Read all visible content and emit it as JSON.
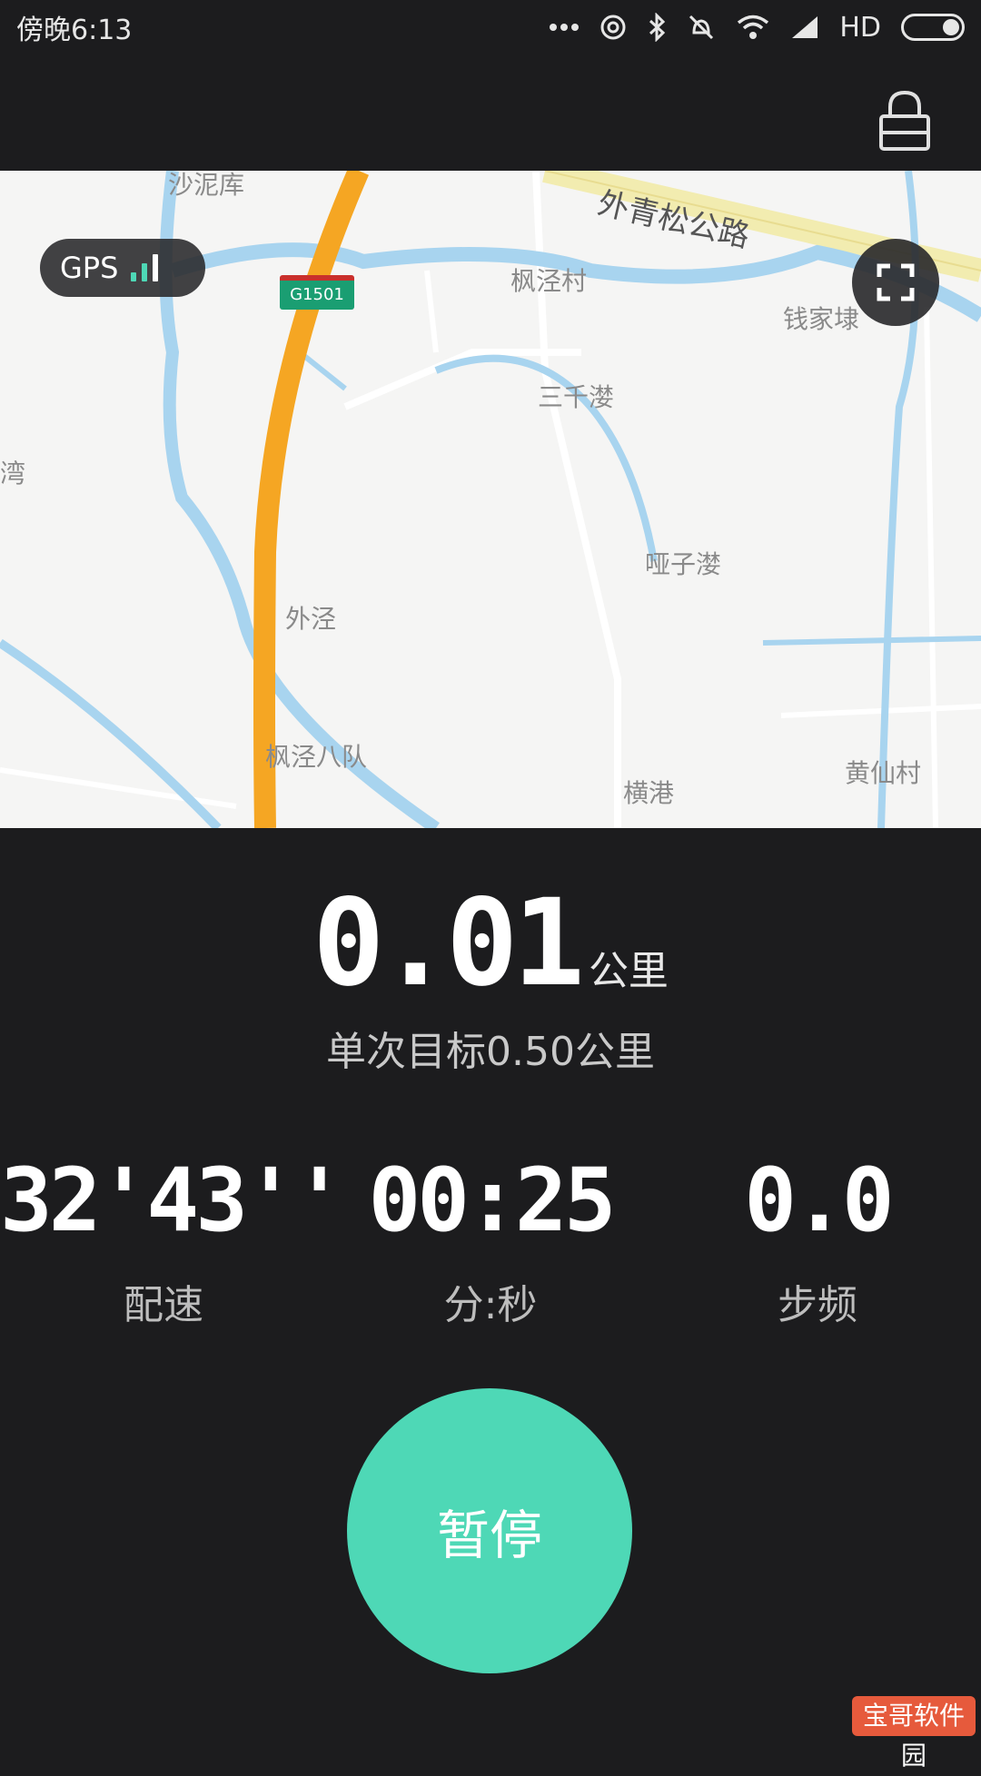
{
  "status": {
    "time": "傍晚6:13",
    "network": "HD"
  },
  "map": {
    "gps_label": "GPS",
    "highway_shield": "G1501",
    "road_name": "外青松公路",
    "places": [
      "沙泥库",
      "枫泾村",
      "钱家埭",
      "三千漤",
      "湾",
      "哑子漤",
      "外泾",
      "枫泾八队",
      "横港",
      "黄仙村"
    ]
  },
  "run": {
    "distance_value": "0.01",
    "distance_unit": "公里",
    "goal_text": "单次目标0.50公里",
    "metrics": [
      {
        "value": "32'43''",
        "label": "配速"
      },
      {
        "value": "00:25",
        "label": "分:秒"
      },
      {
        "value": "0.0",
        "label": "步频"
      }
    ],
    "pause_label": "暂停"
  },
  "watermark": "宝哥软件园",
  "colors": {
    "accent": "#4ed8b6",
    "background": "#1c1c1e",
    "highway": "#f5a623",
    "water": "#a8d4ef"
  }
}
